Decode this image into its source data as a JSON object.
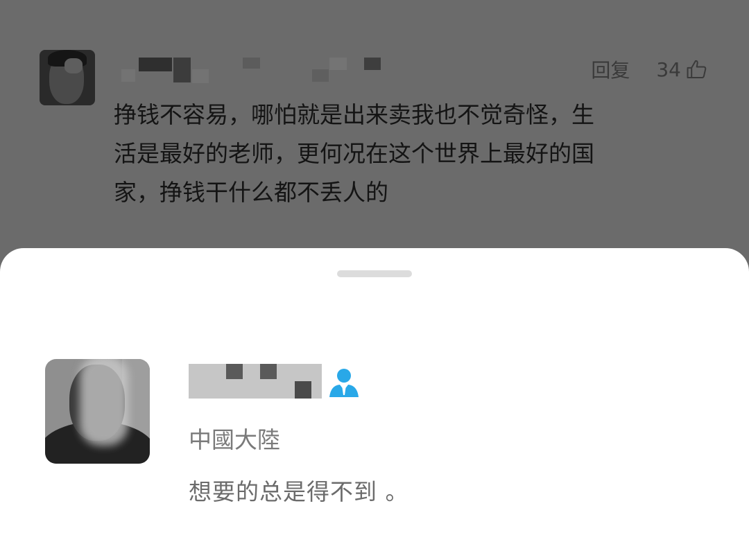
{
  "comment": {
    "reply_label": "回复",
    "like_count": "34",
    "icons": {
      "like": "thumb-up-icon"
    },
    "lines": [
      "挣钱不容易，哪怕就是出来卖我也不觉奇怪，生",
      "活是最好的老师，更何况在这个世界上最好的国",
      "家，挣钱干什么都不丢人的"
    ]
  },
  "profile": {
    "region": "中國大陸",
    "bio": "想要的总是得不到 。",
    "icons": {
      "verified": "user-icon"
    },
    "accent_color": "#29a8e8"
  }
}
